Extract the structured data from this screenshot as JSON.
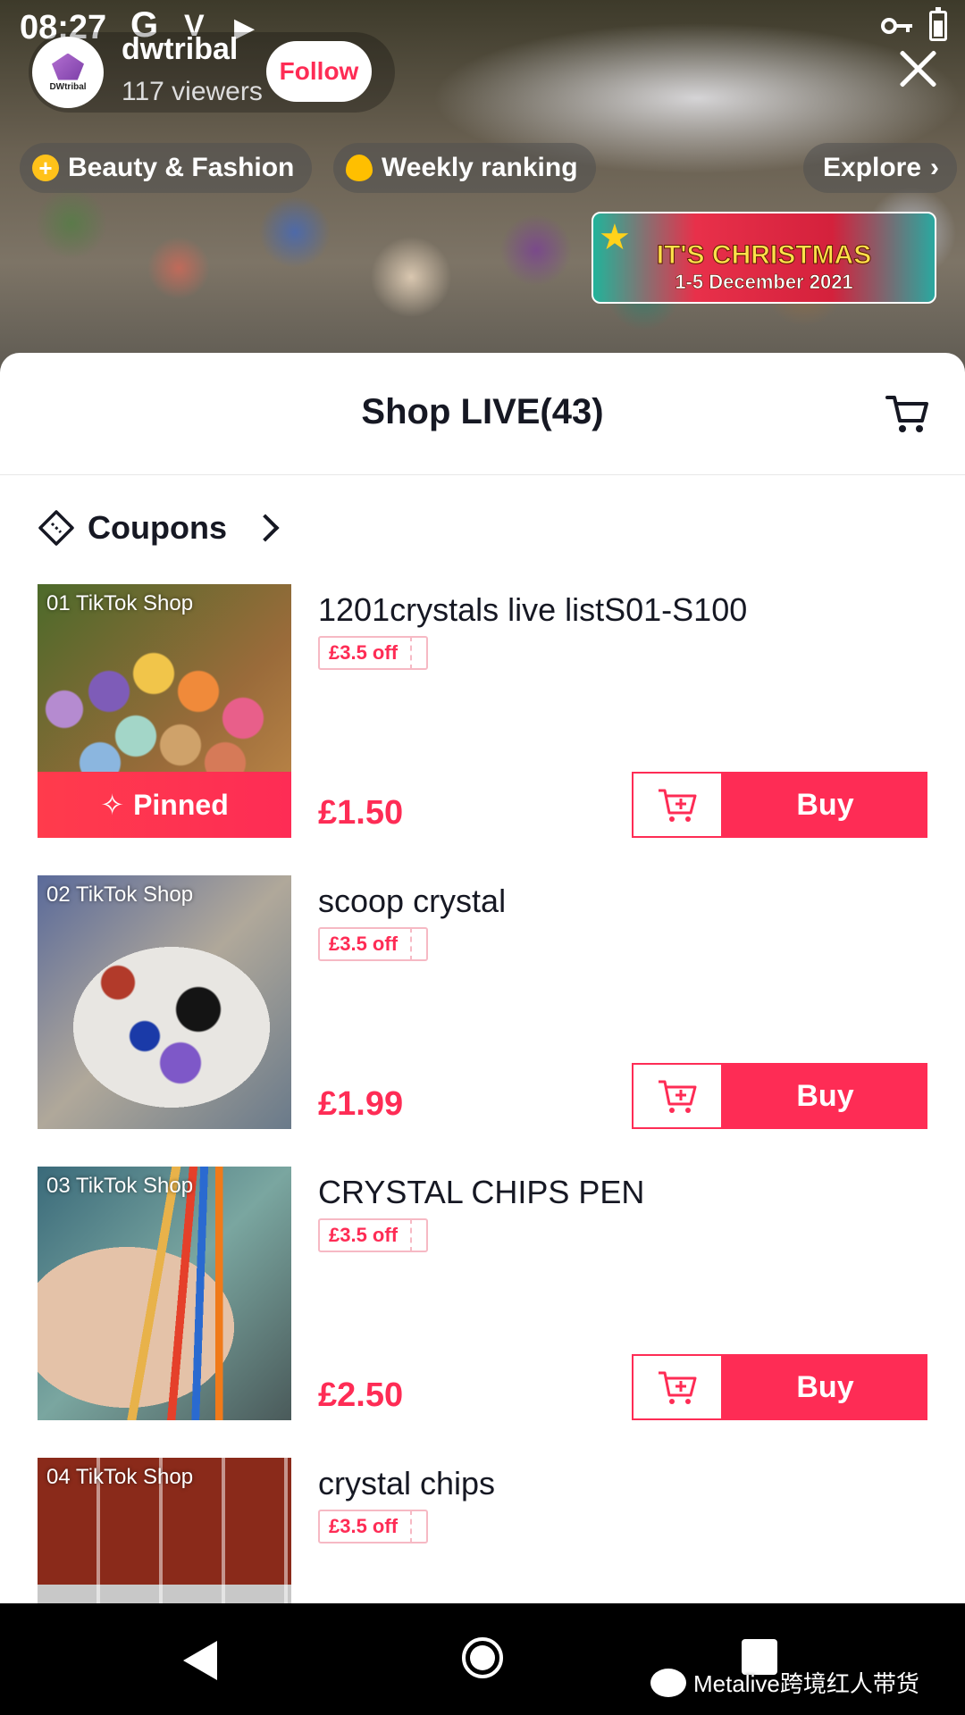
{
  "status_bar": {
    "time": "08:27",
    "glyphs": [
      "G",
      "V"
    ]
  },
  "host": {
    "name": "dwtribal",
    "viewers": "117 viewers",
    "follow_label": "Follow",
    "avatar_text": "DWtribal"
  },
  "chips": [
    {
      "label": "Beauty & Fashion",
      "icon": "plus-coin-icon"
    },
    {
      "label": "Weekly ranking",
      "icon": "flame-icon"
    },
    {
      "label": "Explore",
      "icon": "chevron-right-icon"
    }
  ],
  "banner": {
    "line1": "IT'S CHRISTMAS",
    "line2": "1-5 December 2021"
  },
  "sheet": {
    "title": "Shop LIVE(43)",
    "coupons_label": "Coupons"
  },
  "products": [
    {
      "index_label": "01  TikTok Shop",
      "title": "1201crystals live listS01-S100",
      "coupon": "£3.5 off",
      "price": "£1.50",
      "pinned": "Pinned",
      "buy": "Buy"
    },
    {
      "index_label": "02  TikTok Shop",
      "title": "scoop crystal",
      "coupon": "£3.5 off",
      "price": "£1.99",
      "buy": "Buy"
    },
    {
      "index_label": "03  TikTok Shop",
      "title": "CRYSTAL CHIPS PEN",
      "coupon": "£3.5 off",
      "price": "£2.50",
      "buy": "Buy"
    },
    {
      "index_label": "04  TikTok Shop",
      "title": "crystal chips",
      "coupon": "£3.5 off"
    }
  ],
  "watermark": "Metalive跨境红人带货",
  "colors": {
    "accent": "#fe2c55",
    "title_text": "#161823"
  }
}
